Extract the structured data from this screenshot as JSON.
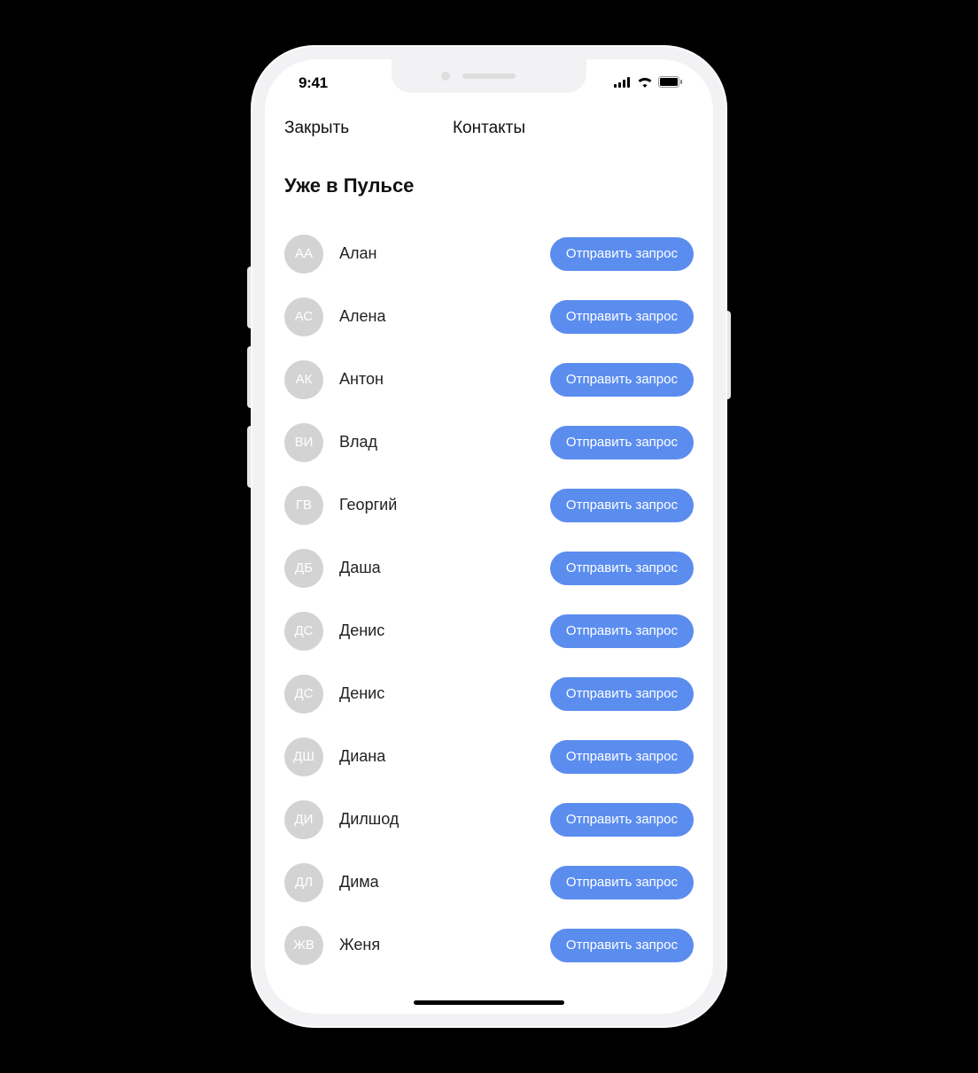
{
  "status": {
    "time": "9:41"
  },
  "nav": {
    "close": "Закрыть",
    "title": "Контакты"
  },
  "section": {
    "title": "Уже в Пульсе"
  },
  "action_label": "Отправить запрос",
  "contacts": [
    {
      "initials": "АА",
      "name": "Алан"
    },
    {
      "initials": "АС",
      "name": "Алена"
    },
    {
      "initials": "АК",
      "name": "Антон"
    },
    {
      "initials": "ВИ",
      "name": "Влад"
    },
    {
      "initials": "ГВ",
      "name": "Георгий"
    },
    {
      "initials": "ДБ",
      "name": "Даша"
    },
    {
      "initials": "ДС",
      "name": "Денис"
    },
    {
      "initials": "ДС",
      "name": "Денис"
    },
    {
      "initials": "ДШ",
      "name": "Диана"
    },
    {
      "initials": "ДИ",
      "name": "Дилшод"
    },
    {
      "initials": "ДЛ",
      "name": "Дима"
    },
    {
      "initials": "ЖВ",
      "name": "Женя"
    }
  ]
}
